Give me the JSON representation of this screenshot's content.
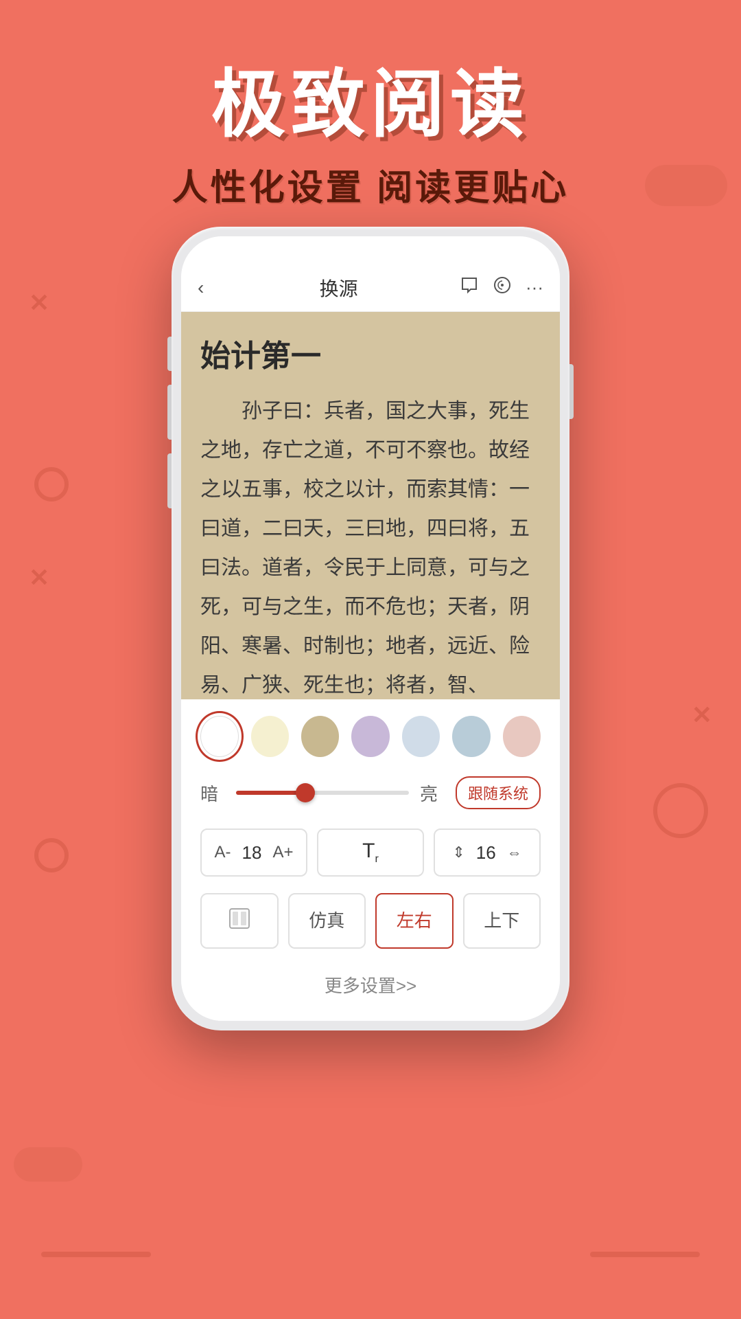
{
  "background": {
    "color": "#F07060"
  },
  "header": {
    "main_title": "极致阅读",
    "sub_title": "人性化设置  阅读更贴心"
  },
  "phone": {
    "navbar": {
      "back_icon": "‹",
      "title": "换源",
      "chat_icon": "💬",
      "audio_icon": "🎧",
      "more_icon": "···"
    },
    "reading": {
      "chapter_title": "始计第一",
      "content": "孙子曰：兵者，国之大事，死生之地，存亡之道，不可不察也。故经之以五事，校之以计，而索其情：一曰道，二曰天，三曰地，四曰将，五曰法。道者，令民于上同意，可与之死，可与之生，而不危也；天者，阴阳、寒暑、时制也；地者，远近、险易、广狭、死生也；将者，智、"
    },
    "settings": {
      "colors": [
        {
          "name": "white",
          "hex": "#ffffff",
          "selected": true
        },
        {
          "name": "cream",
          "hex": "#f5f0d0"
        },
        {
          "name": "tan",
          "hex": "#c8b890"
        },
        {
          "name": "lavender",
          "hex": "#c8b8d8"
        },
        {
          "name": "light-blue",
          "hex": "#d0dce8"
        },
        {
          "name": "powder-blue",
          "hex": "#b8ccd8"
        },
        {
          "name": "pink",
          "hex": "#e8c8c0"
        }
      ],
      "brightness": {
        "dark_label": "暗",
        "light_label": "亮",
        "system_btn": "跟随系统",
        "value": 40
      },
      "font_size": {
        "decrease_btn": "A-",
        "value": "18",
        "increase_btn": "A+"
      },
      "font_family": {
        "icon": "Tr"
      },
      "line_spacing": {
        "icon": "⇕",
        "value": "16",
        "icon2": "⇔"
      },
      "modes": [
        {
          "id": "scroll-mode",
          "icon": "⊡",
          "label": ""
        },
        {
          "id": "classic-mode",
          "label": "仿真"
        },
        {
          "id": "lr-mode",
          "label": "左右",
          "active": true
        },
        {
          "id": "tb-mode",
          "label": "上下"
        }
      ],
      "more_settings": "更多设置>>"
    }
  }
}
